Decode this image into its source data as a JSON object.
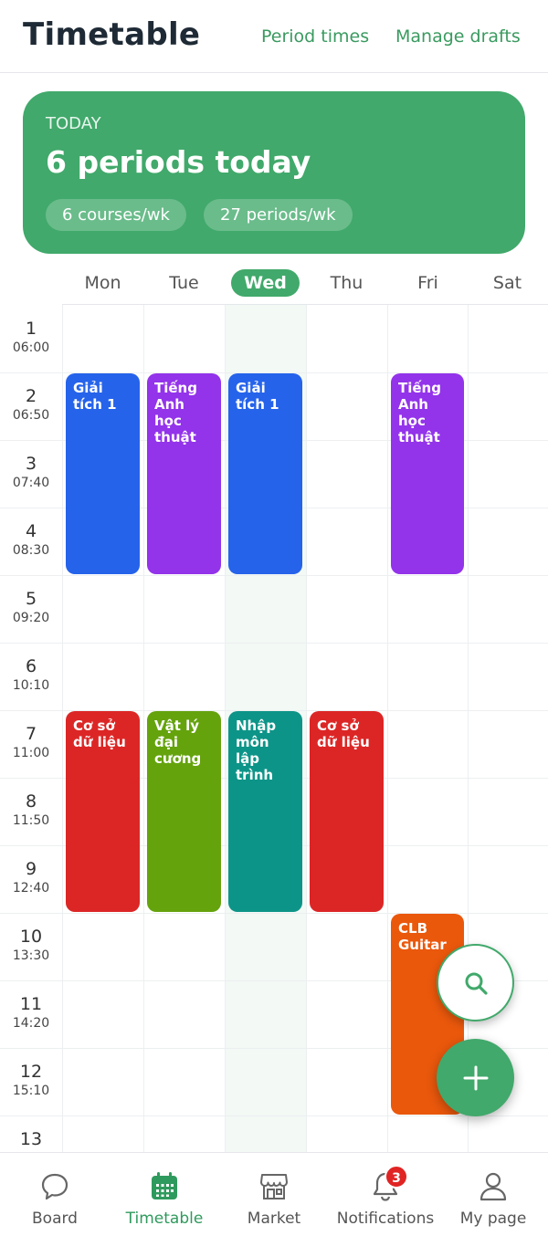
{
  "header": {
    "title": "Timetable",
    "period_times_label": "Period times",
    "manage_drafts_label": "Manage drafts"
  },
  "today_card": {
    "label": "TODAY",
    "summary": "6 periods today",
    "chips": [
      "6 courses/wk",
      "27 periods/wk"
    ]
  },
  "days": [
    {
      "label": "Mon",
      "active": false
    },
    {
      "label": "Tue",
      "active": false
    },
    {
      "label": "Wed",
      "active": true
    },
    {
      "label": "Thu",
      "active": false
    },
    {
      "label": "Fri",
      "active": false
    },
    {
      "label": "Sat",
      "active": false
    }
  ],
  "periods": [
    {
      "num": "1",
      "time": "06:00"
    },
    {
      "num": "2",
      "time": "06:50"
    },
    {
      "num": "3",
      "time": "07:40"
    },
    {
      "num": "4",
      "time": "08:30"
    },
    {
      "num": "5",
      "time": "09:20"
    },
    {
      "num": "6",
      "time": "10:10"
    },
    {
      "num": "7",
      "time": "11:00"
    },
    {
      "num": "8",
      "time": "11:50"
    },
    {
      "num": "9",
      "time": "12:40"
    },
    {
      "num": "10",
      "time": "13:30"
    },
    {
      "num": "11",
      "time": "14:20"
    },
    {
      "num": "12",
      "time": "15:10"
    },
    {
      "num": "13",
      "time": ""
    }
  ],
  "events": [
    {
      "name": "Giải tích 1",
      "day": 0,
      "start": 2,
      "end": 4,
      "color": "#2563eb"
    },
    {
      "name": "Tiếng Anh học thuật",
      "day": 1,
      "start": 2,
      "end": 4,
      "color": "#9333ea"
    },
    {
      "name": "Giải tích 1",
      "day": 2,
      "start": 2,
      "end": 4,
      "color": "#2563eb"
    },
    {
      "name": "Tiếng Anh học thuật",
      "day": 4,
      "start": 2,
      "end": 4,
      "color": "#9333ea"
    },
    {
      "name": "Cơ sở dữ liệu",
      "day": 0,
      "start": 7,
      "end": 9,
      "color": "#dc2626"
    },
    {
      "name": "Vật lý đại cương",
      "day": 1,
      "start": 7,
      "end": 9,
      "color": "#65a30d"
    },
    {
      "name": "Nhập môn lập trình",
      "day": 2,
      "start": 7,
      "end": 9,
      "color": "#0d9488"
    },
    {
      "name": "Cơ sở dữ liệu",
      "day": 3,
      "start": 7,
      "end": 9,
      "color": "#dc2626"
    },
    {
      "name": "CLB Guitar",
      "day": 4,
      "start": 10,
      "end": 12,
      "color": "#ea580c"
    }
  ],
  "fabs": {
    "search_icon": "search-icon",
    "add_icon": "plus-icon"
  },
  "tabbar": {
    "items": [
      {
        "label": "Board",
        "icon": "chat-bubble-icon",
        "active": false
      },
      {
        "label": "Timetable",
        "icon": "calendar-icon",
        "active": true
      },
      {
        "label": "Market",
        "icon": "storefront-icon",
        "active": false
      },
      {
        "label": "Notifications",
        "icon": "bell-icon",
        "active": false
      },
      {
        "label": "My page",
        "icon": "person-icon",
        "active": false
      }
    ],
    "notifications_badge": "3"
  },
  "colors": {
    "accent": "#41a96b",
    "today_column": "#f3f9f5"
  }
}
